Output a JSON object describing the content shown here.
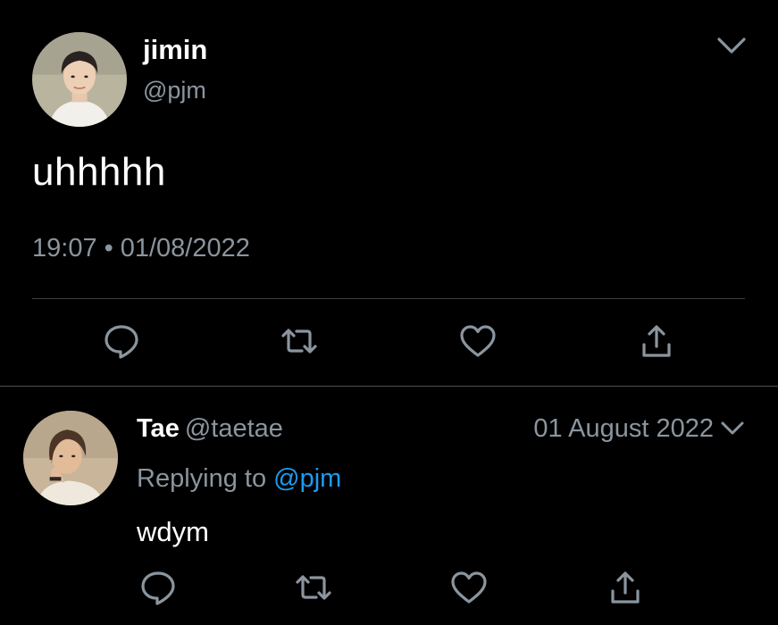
{
  "main_tweet": {
    "display_name": "jimin",
    "handle": "@pjm",
    "text": "uhhhhh",
    "time": "19:07",
    "separator": "•",
    "date": "01/08/2022"
  },
  "reply_tweet": {
    "display_name": "Tae",
    "handle": "@taetae",
    "date": "01 August 2022",
    "replying_prefix": "Replying to",
    "replying_handle": "@pjm",
    "text": "wdym"
  },
  "actions": [
    "reply-icon",
    "retweet-icon",
    "like-icon",
    "share-icon"
  ],
  "colors": {
    "background": "#000000",
    "text_primary": "#ffffff",
    "text_secondary": "#8b959e",
    "link": "#1d9bf0",
    "divider": "#3a3f44"
  }
}
